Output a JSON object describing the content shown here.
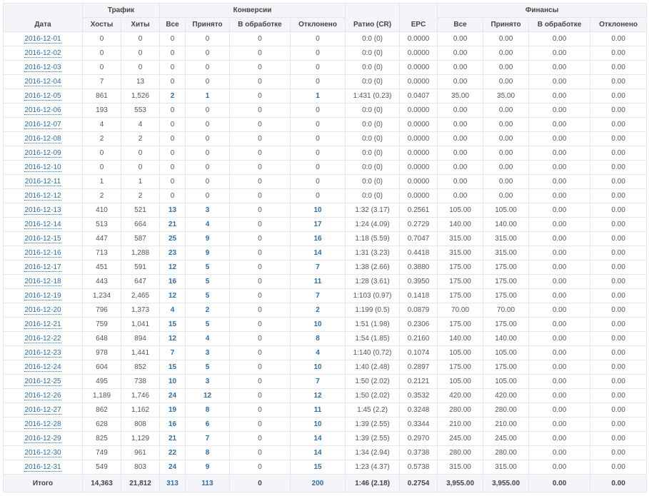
{
  "header": {
    "groups": {
      "traffic": "Трафик",
      "conversions": "Конверсии",
      "finance": "Финансы"
    },
    "columns": {
      "date": "Дата",
      "hosts": "Хосты",
      "hits": "Хиты",
      "conv_all": "Все",
      "conv_accepted": "Принято",
      "conv_processing": "В обработке",
      "conv_rejected": "Отклонено",
      "ratio": "Ратио (CR)",
      "epc": "EPC",
      "fin_all": "Все",
      "fin_accepted": "Принято",
      "fin_processing": "В обработке",
      "fin_rejected": "Отклонено"
    }
  },
  "rows": [
    [
      "2016-12-01",
      "0",
      "0",
      "0",
      "0",
      "0",
      "0",
      "0:0 (0)",
      "0.0000",
      "0.00",
      "0.00",
      "0.00",
      "0.00"
    ],
    [
      "2016-12-02",
      "0",
      "0",
      "0",
      "0",
      "0",
      "0",
      "0:0 (0)",
      "0.0000",
      "0.00",
      "0.00",
      "0.00",
      "0.00"
    ],
    [
      "2016-12-03",
      "0",
      "0",
      "0",
      "0",
      "0",
      "0",
      "0:0 (0)",
      "0.0000",
      "0.00",
      "0.00",
      "0.00",
      "0.00"
    ],
    [
      "2016-12-04",
      "7",
      "13",
      "0",
      "0",
      "0",
      "0",
      "0:0 (0)",
      "0.0000",
      "0.00",
      "0.00",
      "0.00",
      "0.00"
    ],
    [
      "2016-12-05",
      "861",
      "1,526",
      "2",
      "1",
      "0",
      "1",
      "1:431 (0.23)",
      "0.0407",
      "35.00",
      "35.00",
      "0.00",
      "0.00"
    ],
    [
      "2016-12-06",
      "193",
      "553",
      "0",
      "0",
      "0",
      "0",
      "0:0 (0)",
      "0.0000",
      "0.00",
      "0.00",
      "0.00",
      "0.00"
    ],
    [
      "2016-12-07",
      "4",
      "4",
      "0",
      "0",
      "0",
      "0",
      "0:0 (0)",
      "0.0000",
      "0.00",
      "0.00",
      "0.00",
      "0.00"
    ],
    [
      "2016-12-08",
      "2",
      "2",
      "0",
      "0",
      "0",
      "0",
      "0:0 (0)",
      "0.0000",
      "0.00",
      "0.00",
      "0.00",
      "0.00"
    ],
    [
      "2016-12-09",
      "0",
      "0",
      "0",
      "0",
      "0",
      "0",
      "0:0 (0)",
      "0.0000",
      "0.00",
      "0.00",
      "0.00",
      "0.00"
    ],
    [
      "2016-12-10",
      "0",
      "0",
      "0",
      "0",
      "0",
      "0",
      "0:0 (0)",
      "0.0000",
      "0.00",
      "0.00",
      "0.00",
      "0.00"
    ],
    [
      "2016-12-11",
      "1",
      "1",
      "0",
      "0",
      "0",
      "0",
      "0:0 (0)",
      "0.0000",
      "0.00",
      "0.00",
      "0.00",
      "0.00"
    ],
    [
      "2016-12-12",
      "2",
      "2",
      "0",
      "0",
      "0",
      "0",
      "0:0 (0)",
      "0.0000",
      "0.00",
      "0.00",
      "0.00",
      "0.00"
    ],
    [
      "2016-12-13",
      "410",
      "521",
      "13",
      "3",
      "0",
      "10",
      "1:32 (3.17)",
      "0.2561",
      "105.00",
      "105.00",
      "0.00",
      "0.00"
    ],
    [
      "2016-12-14",
      "513",
      "664",
      "21",
      "4",
      "0",
      "17",
      "1:24 (4.09)",
      "0.2729",
      "140.00",
      "140.00",
      "0.00",
      "0.00"
    ],
    [
      "2016-12-15",
      "447",
      "587",
      "25",
      "9",
      "0",
      "16",
      "1:18 (5.59)",
      "0.7047",
      "315.00",
      "315.00",
      "0.00",
      "0.00"
    ],
    [
      "2016-12-16",
      "713",
      "1,288",
      "23",
      "9",
      "0",
      "14",
      "1:31 (3.23)",
      "0.4418",
      "315.00",
      "315.00",
      "0.00",
      "0.00"
    ],
    [
      "2016-12-17",
      "451",
      "591",
      "12",
      "5",
      "0",
      "7",
      "1:38 (2.66)",
      "0.3880",
      "175.00",
      "175.00",
      "0.00",
      "0.00"
    ],
    [
      "2016-12-18",
      "443",
      "647",
      "16",
      "5",
      "0",
      "11",
      "1:28 (3.61)",
      "0.3950",
      "175.00",
      "175.00",
      "0.00",
      "0.00"
    ],
    [
      "2016-12-19",
      "1,234",
      "2,465",
      "12",
      "5",
      "0",
      "7",
      "1:103 (0.97)",
      "0.1418",
      "175.00",
      "175.00",
      "0.00",
      "0.00"
    ],
    [
      "2016-12-20",
      "796",
      "1,373",
      "4",
      "2",
      "0",
      "2",
      "1:199 (0.5)",
      "0.0879",
      "70.00",
      "70.00",
      "0.00",
      "0.00"
    ],
    [
      "2016-12-21",
      "759",
      "1,041",
      "15",
      "5",
      "0",
      "10",
      "1:51 (1.98)",
      "0.2306",
      "175.00",
      "175.00",
      "0.00",
      "0.00"
    ],
    [
      "2016-12-22",
      "648",
      "894",
      "12",
      "4",
      "0",
      "8",
      "1:54 (1.85)",
      "0.2160",
      "140.00",
      "140.00",
      "0.00",
      "0.00"
    ],
    [
      "2016-12-23",
      "978",
      "1,441",
      "7",
      "3",
      "0",
      "4",
      "1:140 (0.72)",
      "0.1074",
      "105.00",
      "105.00",
      "0.00",
      "0.00"
    ],
    [
      "2016-12-24",
      "604",
      "852",
      "15",
      "5",
      "0",
      "10",
      "1:40 (2.48)",
      "0.2897",
      "175.00",
      "175.00",
      "0.00",
      "0.00"
    ],
    [
      "2016-12-25",
      "495",
      "738",
      "10",
      "3",
      "0",
      "7",
      "1:50 (2.02)",
      "0.2121",
      "105.00",
      "105.00",
      "0.00",
      "0.00"
    ],
    [
      "2016-12-26",
      "1,189",
      "1,746",
      "24",
      "12",
      "0",
      "12",
      "1:50 (2.02)",
      "0.3532",
      "420.00",
      "420.00",
      "0.00",
      "0.00"
    ],
    [
      "2016-12-27",
      "862",
      "1,162",
      "19",
      "8",
      "0",
      "11",
      "1:45 (2.2)",
      "0.3248",
      "280.00",
      "280.00",
      "0.00",
      "0.00"
    ],
    [
      "2016-12-28",
      "628",
      "808",
      "16",
      "6",
      "0",
      "10",
      "1:39 (2.55)",
      "0.3344",
      "210.00",
      "210.00",
      "0.00",
      "0.00"
    ],
    [
      "2016-12-29",
      "825",
      "1,129",
      "21",
      "7",
      "0",
      "14",
      "1:39 (2.55)",
      "0.2970",
      "245.00",
      "245.00",
      "0.00",
      "0.00"
    ],
    [
      "2016-12-30",
      "749",
      "961",
      "22",
      "8",
      "0",
      "14",
      "1:34 (2.94)",
      "0.3738",
      "280.00",
      "280.00",
      "0.00",
      "0.00"
    ],
    [
      "2016-12-31",
      "549",
      "803",
      "24",
      "9",
      "0",
      "15",
      "1:23 (4.37)",
      "0.5738",
      "315.00",
      "315.00",
      "0.00",
      "0.00"
    ]
  ],
  "totals": [
    "Итого",
    "14,363",
    "21,812",
    "313",
    "113",
    "0",
    "200",
    "1:46 (2.18)",
    "0.2754",
    "3,955.00",
    "3,955.00",
    "0.00",
    "0.00"
  ],
  "colors": {
    "link": "#2e6da4",
    "header_bg": "#f3f5f8",
    "border": "#e3e6ea"
  }
}
